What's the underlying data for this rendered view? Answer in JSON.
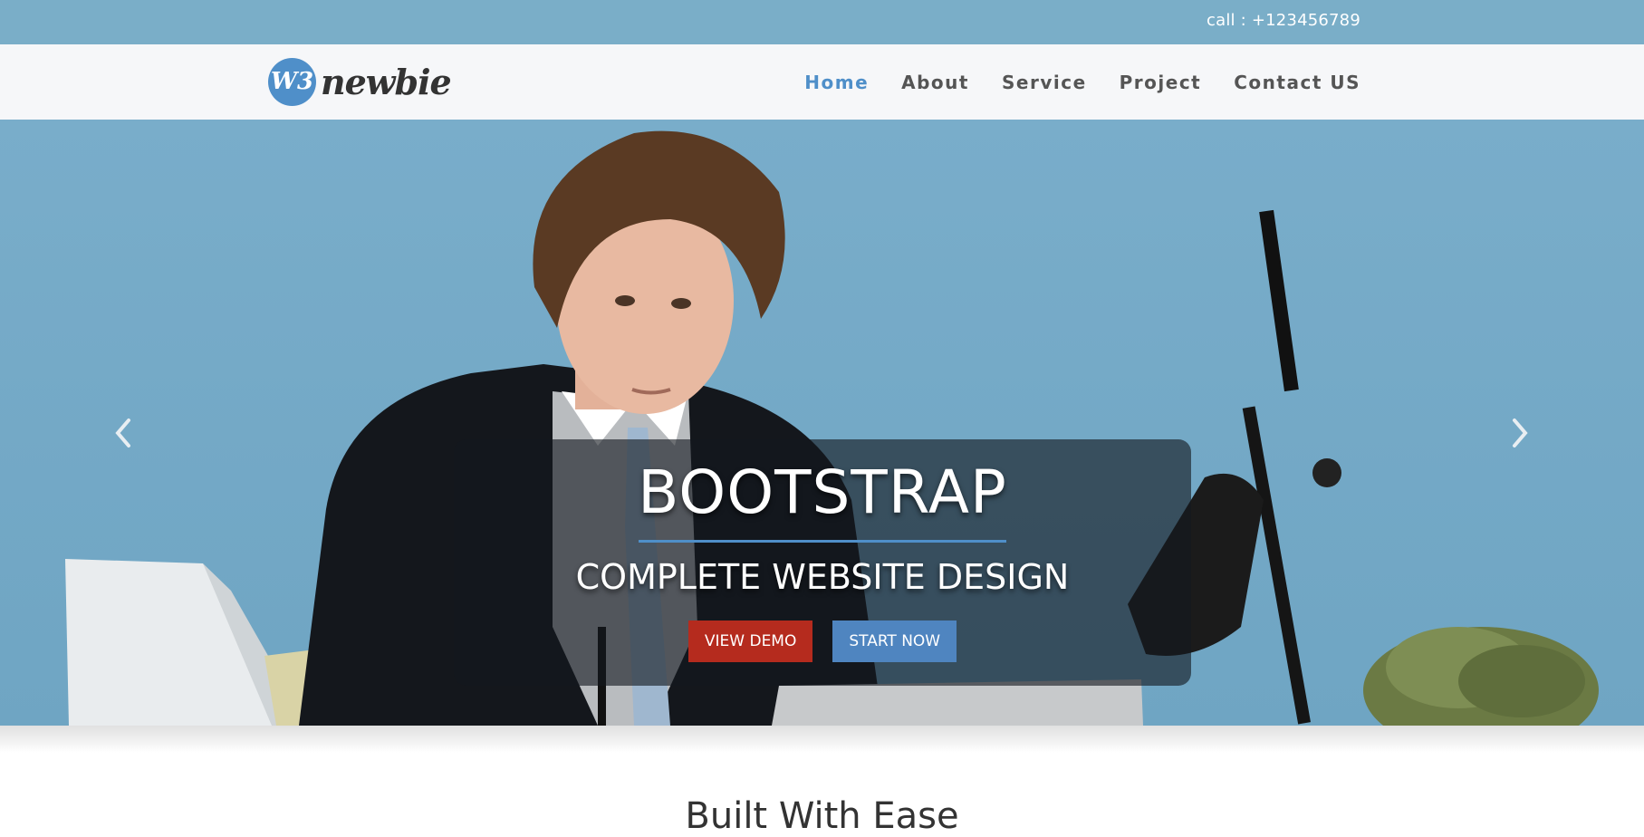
{
  "topbar": {
    "call_text": "call : +123456789"
  },
  "brand": {
    "badge": "W3",
    "name": "newbie",
    "accent_color": "#4f8fc9"
  },
  "nav": {
    "items": [
      {
        "label": "Home",
        "active": true
      },
      {
        "label": "About",
        "active": false
      },
      {
        "label": "Service",
        "active": false
      },
      {
        "label": "Project",
        "active": false
      },
      {
        "label": "Contact US",
        "active": false
      }
    ]
  },
  "hero": {
    "title": "BOOTSTRAP",
    "subtitle": "COMPLETE WEBSITE DESIGN",
    "primary_button": "VIEW DEMO",
    "secondary_button": "START NOW",
    "prev_icon": "chevron-left-icon",
    "next_icon": "chevron-right-icon",
    "primary_color": "#b52b1e",
    "secondary_color": "#4f85c0"
  },
  "section": {
    "title": "Built With Ease"
  }
}
